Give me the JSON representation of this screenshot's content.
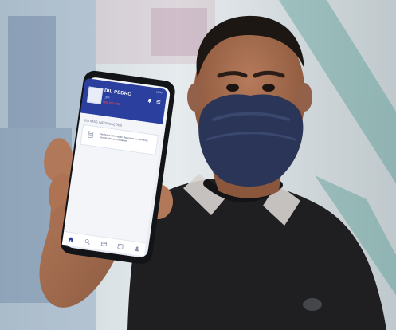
{
  "app": {
    "user_name": "DIL PEDRO",
    "user_label": "CPF",
    "user_id_masked": "000.000.000",
    "status_time": "15:30"
  },
  "content": {
    "section_title": "ÚLTIMAS INFORMAÇÕES",
    "card_text": "Nenhuma informação disponível no momento. Acompanhe as novidades."
  },
  "icons": {
    "header": [
      "notification-icon",
      "menu-icon"
    ],
    "card": "document-icon",
    "nav": [
      "home-icon",
      "search-icon",
      "card-icon",
      "calendar-icon",
      "profile-icon"
    ]
  },
  "colors": {
    "app_header": "#2b3f9e",
    "mask": "#2a3558",
    "shirt": "#1f1f22"
  }
}
